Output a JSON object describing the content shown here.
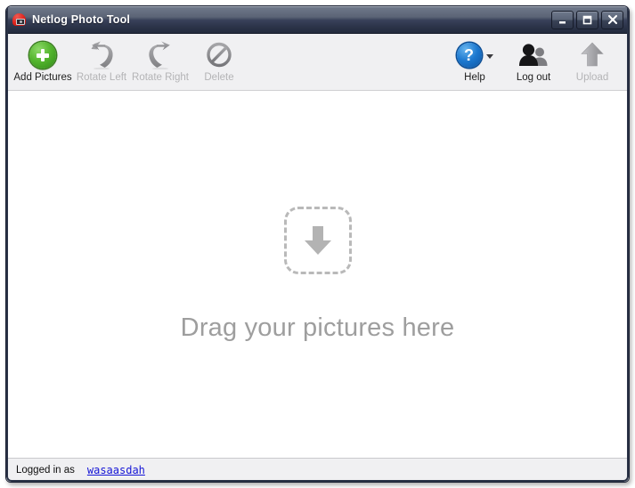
{
  "window": {
    "title": "Netlog Photo Tool",
    "app_icon": "netlog-camera-icon",
    "controls": {
      "minimize": "minimize-button",
      "maximize": "maximize-button",
      "close": "close-button"
    }
  },
  "toolbar": {
    "left_items": [
      {
        "label": "Add Pictures",
        "icon": "add-plus-icon",
        "enabled": true
      },
      {
        "label": "Rotate Left",
        "icon": "rotate-left-icon",
        "enabled": false
      },
      {
        "label": "Rotate Right",
        "icon": "rotate-right-icon",
        "enabled": false
      },
      {
        "label": "Delete",
        "icon": "delete-forbid-icon",
        "enabled": false
      }
    ],
    "right_items": [
      {
        "label": "Help",
        "icon": "help-question-icon",
        "enabled": true,
        "has_dropdown": true
      },
      {
        "label": "Log out",
        "icon": "users-icon",
        "enabled": true,
        "has_dropdown": false
      },
      {
        "label": "Upload",
        "icon": "upload-arrow-icon",
        "enabled": false,
        "has_dropdown": false
      }
    ]
  },
  "content": {
    "drop_icon": "download-arrow-dashed-box-icon",
    "drop_text": "Drag your pictures here"
  },
  "statusbar": {
    "label": "Logged in as",
    "username": "wasaasdah"
  },
  "colors": {
    "titlebar_top": "#6d7688",
    "titlebar_bottom": "#232b3e",
    "toolbar_bg": "#f0f0f2",
    "content_bg": "#ffffff",
    "accent_green": "#55b62f",
    "accent_blue": "#1c78cf",
    "link_blue": "#1414d6",
    "disabled_gray": "#b4b4b6",
    "drop_gray": "#b9b9b9",
    "drag_text_gray": "#9e9e9e"
  }
}
